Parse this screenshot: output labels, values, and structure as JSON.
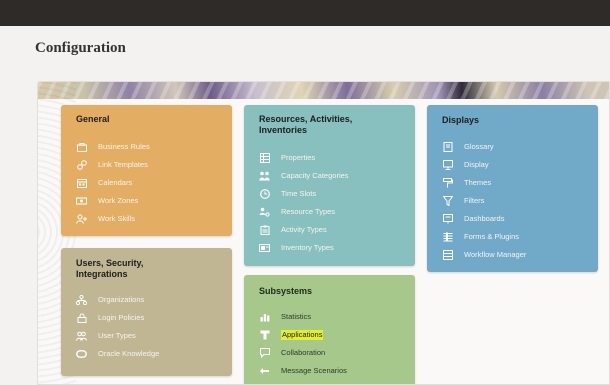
{
  "page": {
    "title": "Configuration"
  },
  "colors": {
    "general": "#e3ad64",
    "users": "#c0b693",
    "resources": "#88c0bf",
    "subsystems": "#a6c88b",
    "displays": "#71a9c9",
    "highlight": "#e5ee2f"
  },
  "cards": {
    "general": {
      "title": "General",
      "items": [
        {
          "label": "Business Rules",
          "icon": "briefcase-icon"
        },
        {
          "label": "Link Templates",
          "icon": "link-icon"
        },
        {
          "label": "Calendars",
          "icon": "calendar-icon"
        },
        {
          "label": "Work Zones",
          "icon": "map-pin-icon"
        },
        {
          "label": "Work Skills",
          "icon": "person-plus-icon"
        }
      ]
    },
    "users": {
      "title": "Users, Security, Integrations",
      "items": [
        {
          "label": "Organizations",
          "icon": "organization-icon"
        },
        {
          "label": "Login Policies",
          "icon": "lock-icon"
        },
        {
          "label": "User Types",
          "icon": "users-icon"
        },
        {
          "label": "Oracle Knowledge",
          "icon": "oracle-icon"
        }
      ]
    },
    "resources": {
      "title": "Resources, Activities, Inventories",
      "items": [
        {
          "label": "Properties",
          "icon": "grid-icon"
        },
        {
          "label": "Capacity Categories",
          "icon": "people-group-icon"
        },
        {
          "label": "Time Slots",
          "icon": "clock-icon"
        },
        {
          "label": "Resource Types",
          "icon": "person-gear-icon"
        },
        {
          "label": "Activity Types",
          "icon": "clipboard-icon"
        },
        {
          "label": "Inventory Types",
          "icon": "inventory-icon"
        }
      ]
    },
    "subsystems": {
      "title": "Subsystems",
      "items": [
        {
          "label": "Statistics",
          "icon": "bar-chart-icon"
        },
        {
          "label": "Applications",
          "icon": "application-icon",
          "highlighted": true
        },
        {
          "label": "Collaboration",
          "icon": "chat-icon"
        },
        {
          "label": "Message Scenarios",
          "icon": "message-flow-icon"
        }
      ]
    },
    "displays": {
      "title": "Displays",
      "items": [
        {
          "label": "Glossary",
          "icon": "book-icon"
        },
        {
          "label": "Display",
          "icon": "monitor-icon"
        },
        {
          "label": "Themes",
          "icon": "paint-roller-icon"
        },
        {
          "label": "Filters",
          "icon": "filter-icon"
        },
        {
          "label": "Dashboards",
          "icon": "dashboard-icon"
        },
        {
          "label": "Forms & Plugins",
          "icon": "form-icon"
        },
        {
          "label": "Workflow Manager",
          "icon": "workflow-icon"
        }
      ]
    }
  }
}
